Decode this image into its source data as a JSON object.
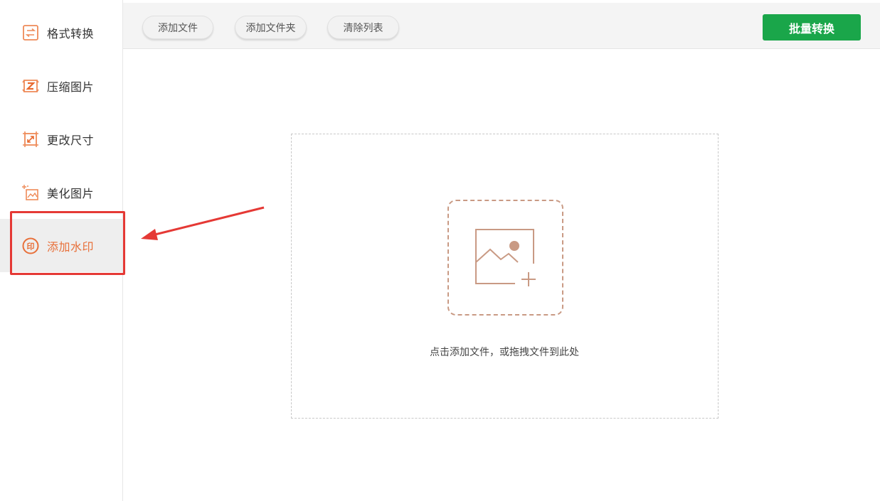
{
  "sidebar": {
    "items": [
      {
        "label": "格式转换",
        "icon": "format-convert-icon"
      },
      {
        "label": "压缩图片",
        "icon": "compress-image-icon"
      },
      {
        "label": "更改尺寸",
        "icon": "resize-icon"
      },
      {
        "label": "美化图片",
        "icon": "beautify-image-icon"
      },
      {
        "label": "添加水印",
        "icon": "watermark-icon",
        "active": true
      }
    ]
  },
  "toolbar": {
    "add_file_label": "添加文件",
    "add_folder_label": "添加文件夹",
    "clear_list_label": "清除列表",
    "batch_convert_label": "批量转换"
  },
  "dropzone": {
    "hint": "点击添加文件，或拖拽文件到此处",
    "icon": "add-image-icon"
  },
  "colors": {
    "accent_orange": "#e8703a",
    "primary_green": "#1aa64a",
    "highlight_red": "#e53935",
    "dropzone_icon": "#c99a84"
  }
}
